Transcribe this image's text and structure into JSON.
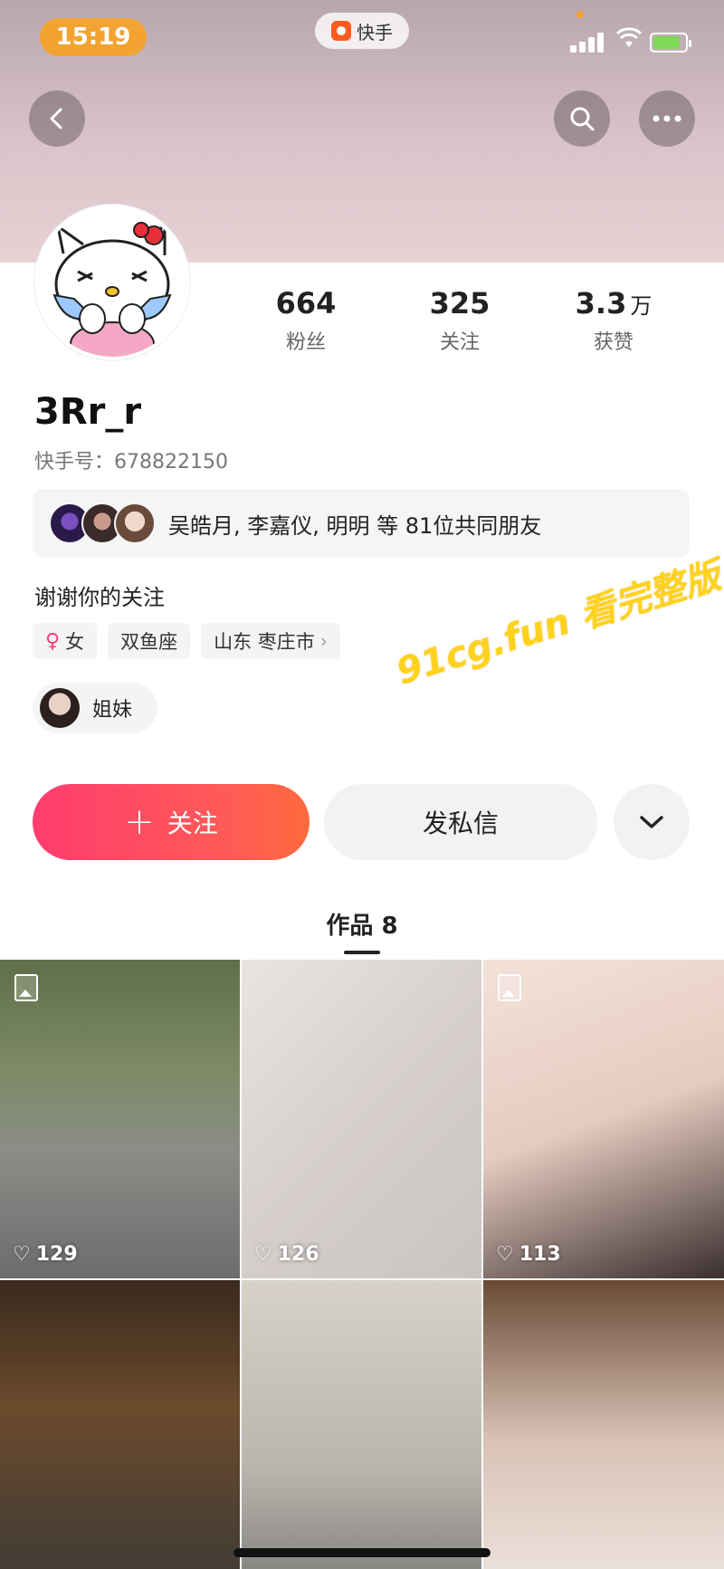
{
  "status_bar": {
    "time": "15:19",
    "app_name": "快手",
    "accent_color": "#f2a332",
    "battery_color": "#7ed957",
    "battery_level": 0.85,
    "signal_bars": 4
  },
  "nav": {
    "back_icon": "chevron-left-icon",
    "search_icon": "search-icon",
    "more_icon": "more-horizontal-icon"
  },
  "profile": {
    "avatar_icon": "hello-kitty-avatar",
    "stats": [
      {
        "value": "664",
        "unit": "",
        "label": "粉丝"
      },
      {
        "value": "325",
        "unit": "",
        "label": "关注"
      },
      {
        "value": "3.3",
        "unit": "万",
        "label": "获赞"
      }
    ],
    "username": "3Rr_r",
    "kuaishou_id": "快手号：678822150",
    "mutual_friends": "吴皓月, 李嘉仪, 明明 等 81位共同朋友",
    "bio": "谢谢你的关注",
    "tags": {
      "gender_symbol": "♀",
      "gender": "女",
      "zodiac": "双鱼座",
      "location": "山东 枣庄市",
      "location_chevron": "›"
    },
    "group_label": "姐妹"
  },
  "watermark": "91cg.fun 看完整版",
  "actions": {
    "follow_plus": "+",
    "follow_label": "关注",
    "message_label": "发私信",
    "follow_gradient": [
      "#ff3c6e",
      "#ff6a3d"
    ]
  },
  "works": {
    "tab_label": "作品 8",
    "items": [
      {
        "likes": "129",
        "image_post": true
      },
      {
        "likes": "126",
        "image_post": false
      },
      {
        "likes": "113",
        "image_post": true
      },
      {
        "likes": "",
        "image_post": false
      },
      {
        "likes": "",
        "image_post": false
      },
      {
        "likes": "",
        "image_post": false
      }
    ]
  }
}
